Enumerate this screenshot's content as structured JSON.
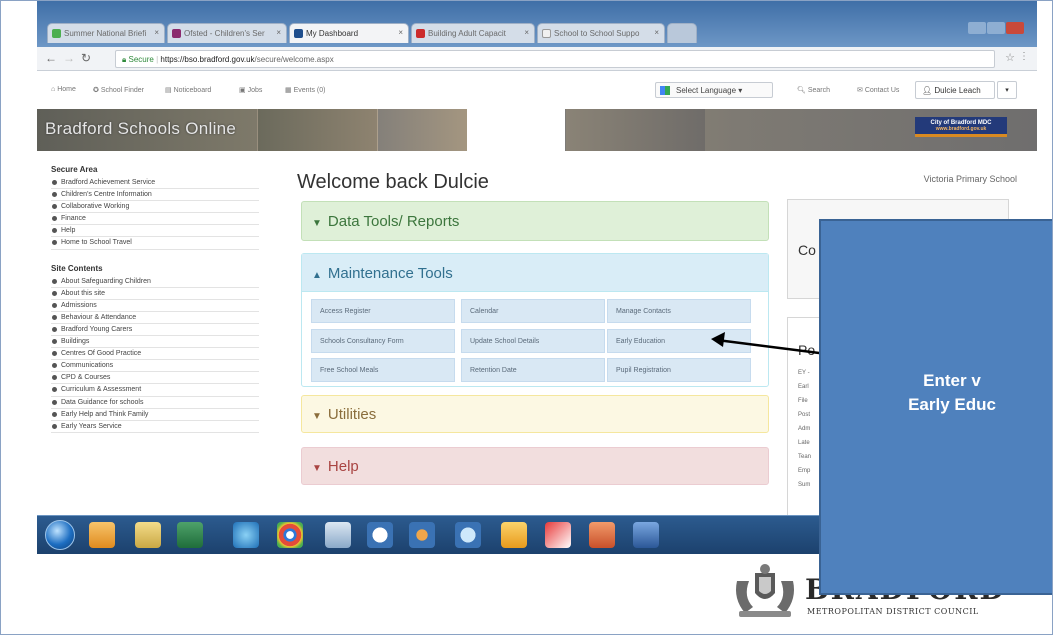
{
  "browser": {
    "tabs": [
      {
        "label": "Summer National Briefi",
        "color": "#4caf50",
        "active": false
      },
      {
        "label": "Ofsted - Children's Ser",
        "color": "#8b2a6d",
        "active": false
      },
      {
        "label": "My Dashboard",
        "color": "#1f4e8c",
        "active": true
      },
      {
        "label": "Building Adult Capacit",
        "color": "#cc2b2b",
        "active": false
      },
      {
        "label": "School to School Suppo",
        "color": "#f0f0f0",
        "active": false
      }
    ],
    "url_secure": "Secure",
    "url_host": "https://bso.bradford.gov.uk",
    "url_path": "/secure/welcome.aspx"
  },
  "sitenav": {
    "home": "Home",
    "school_finder": "School Finder",
    "noticeboard": "Noticeboard",
    "jobs": "Jobs",
    "events": "Events (0)",
    "select_language": "Select Language",
    "search": "Search",
    "contact_us": "Contact Us",
    "user": "Dulcie Leach"
  },
  "banner": {
    "title": "Bradford Schools Online",
    "badge_line1": "City of Bradford MDC",
    "badge_line2": "www.bradford.gov.uk"
  },
  "sidebar": {
    "secure_heading": "Secure Area",
    "secure_items": [
      "Bradford Achievement Service",
      "Children's Centre Information",
      "Collaborative Working",
      "Finance",
      "Help",
      "Home to School Travel"
    ],
    "site_heading": "Site Contents",
    "site_items": [
      "About Safeguarding Children",
      "About this site",
      "Admissions",
      "Behaviour & Attendance",
      "Bradford Young Carers",
      "Buildings",
      "Centres Of Good Practice",
      "Communications",
      "CPD & Courses",
      "Curriculum & Assessment",
      "Data Guidance for schools",
      "Early Help and Think Family",
      "Early Years Service"
    ]
  },
  "main": {
    "welcome": "Welcome back Dulcie",
    "school_name": "Victoria Primary School",
    "data_tools": "Data Tools/ Reports",
    "maintenance_tools": "Maintenance Tools",
    "tools": [
      "Access Register",
      "Calendar",
      "Manage Contacts",
      "Schools Consultancy Form",
      "Update School Details",
      "Early Education",
      "Free School Meals",
      "Retention Date",
      "Pupil Registration"
    ],
    "utilities": "Utilities",
    "help": "Help"
  },
  "right": {
    "box1_title": "Co",
    "box2_title": "Po",
    "box2_items": [
      "EY -",
      "Earl",
      "File",
      "Post",
      "Adm",
      "Late",
      "Tean",
      "Emp",
      "Sum"
    ]
  },
  "callout": {
    "line1": "Enter v",
    "line2": "Early Educ"
  },
  "logo": {
    "word": "BRADFORD",
    "subtitle": "METROPOLITAN DISTRICT COUNCIL"
  },
  "colors": {
    "callout_fill": "#4f81bd",
    "data_panel": "#dff0d8",
    "maint_panel": "#d9edf7",
    "util_panel": "#fcf8e3",
    "help_panel": "#f2dede"
  },
  "icons": {
    "taskbar": [
      "start-orb",
      "outlook-icon",
      "explorer-icon",
      "excel-icon",
      "ie-icon",
      "chrome-icon",
      "notepad-icon",
      "chat-icon",
      "media-icon",
      "network-icon",
      "folder-icon",
      "acrobat-icon",
      "powerpoint-icon",
      "word-icon"
    ]
  }
}
